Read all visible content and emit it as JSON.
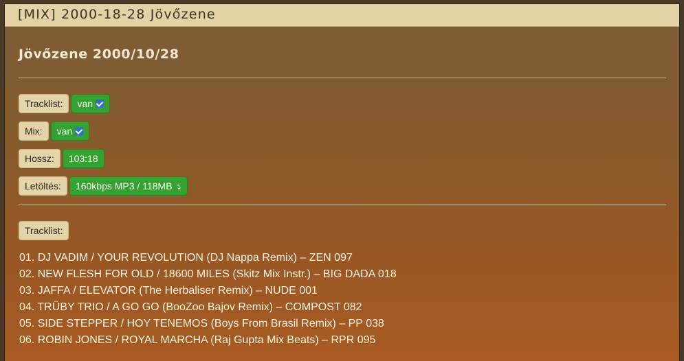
{
  "window": {
    "title": "[MIX] 2000-18-28 Jövőzene"
  },
  "page": {
    "heading": "Jövőzene 2000/10/28"
  },
  "info": {
    "tracklist_label": "Tracklist:",
    "tracklist_value": "van",
    "mix_label": "Mix:",
    "mix_value": "van",
    "length_label": "Hossz:",
    "length_value": "103:18",
    "download_label": "Letöltés:",
    "download_value": "160kbps MP3 / 118MB"
  },
  "tracklist": {
    "label": "Tracklist:",
    "tracks": [
      "01. DJ VADIM / YOUR REVOLUTION (DJ Nappa Remix) – ZEN 097",
      "02. NEW FLESH FOR OLD / 18600 MILES (Skitz Mix Instr.) – BIG DADA 018",
      "03. JAFFA / ELEVATOR (The Herbaliser Remix) – NUDE 001",
      "04. TRÜBY TRIO / A GO GO (BooZoo Bajov Remix) – COMPOST 082",
      "05. SIDE STEPPER / HOY TENEMOS (Boys From Brasil Remix) – PP 038",
      "06. ROBIN JONES / ROYAL MARCHA (Raj Gupta Mix Beats) – RPR 095"
    ]
  },
  "icons": {
    "check": "check-icon",
    "download": "download-arrow-icon"
  },
  "colors": {
    "titlebar": "#e2d2a6",
    "label_bg": "#e3d4aa",
    "value_bg": "#36a030",
    "check_bg": "#2f6fcf"
  }
}
